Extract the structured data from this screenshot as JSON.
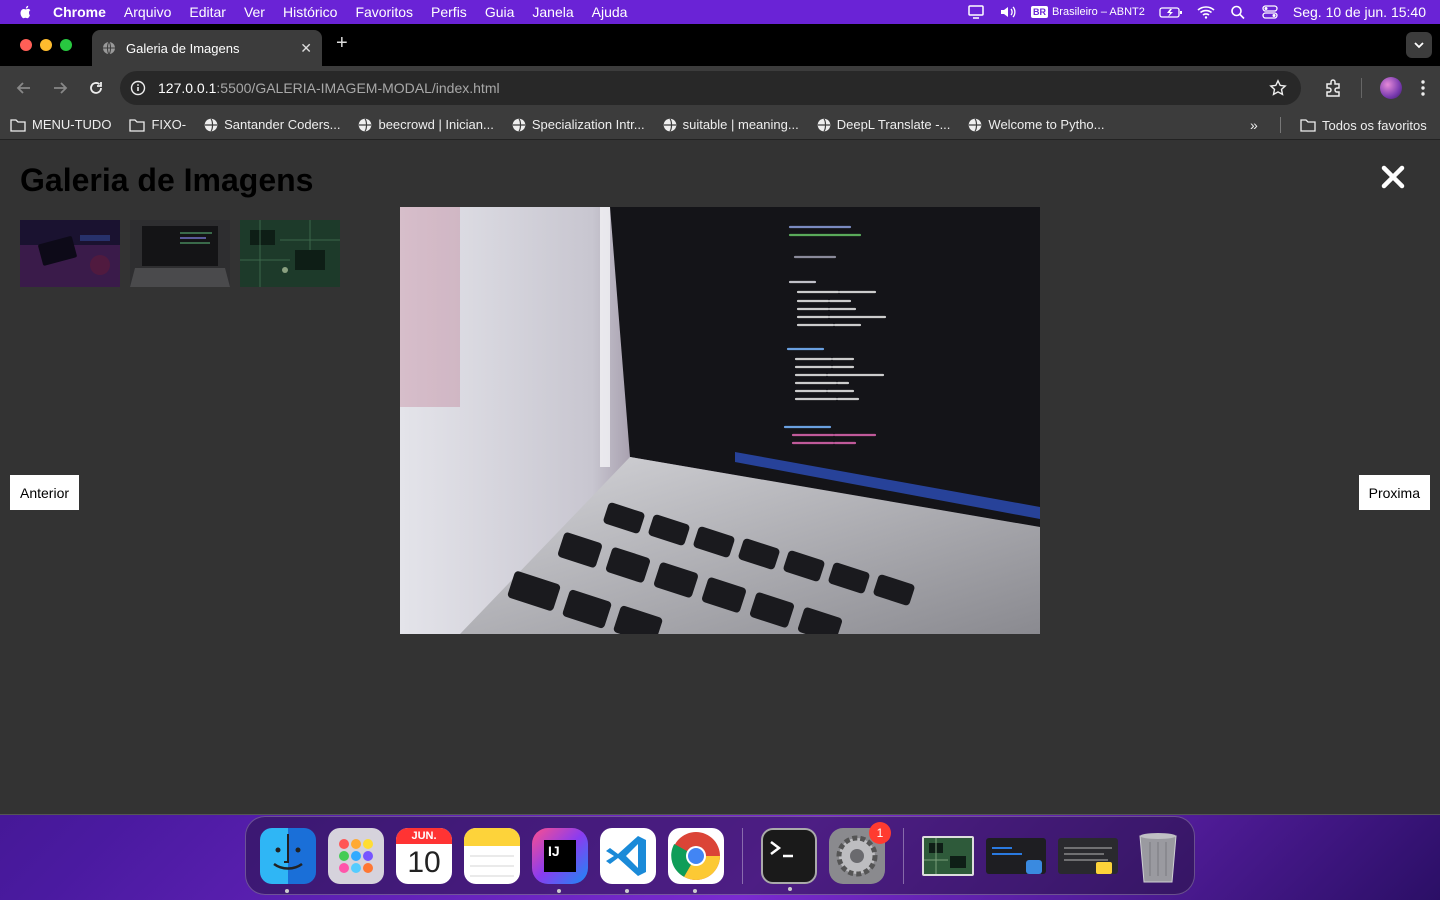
{
  "menubar": {
    "app_name": "Chrome",
    "items": [
      "Arquivo",
      "Editar",
      "Ver",
      "Histórico",
      "Favoritos",
      "Perfis",
      "Guia",
      "Janela",
      "Ajuda"
    ],
    "keyboard_flag": "BR",
    "keyboard_label": "Brasileiro – ABNT2",
    "datetime": "Seg. 10 de jun.  15:40"
  },
  "browser": {
    "tab_title": "Galeria de Imagens",
    "url_host": "127.0.0.1",
    "url_path": ":5500/GALERIA-IMAGEM-MODAL/index.html",
    "bookmarks": [
      {
        "label": "MENU-TUDO",
        "icon": "folder-icon"
      },
      {
        "label": "FIXO-",
        "icon": "folder-icon"
      },
      {
        "label": "Santander Coders...",
        "icon": "globe-icon"
      },
      {
        "label": "beecrowd | Inician...",
        "icon": "globe-icon"
      },
      {
        "label": "Specialization Intr...",
        "icon": "globe-icon"
      },
      {
        "label": "suitable | meaning...",
        "icon": "globe-icon"
      },
      {
        "label": "DeepL Translate -...",
        "icon": "globe-icon"
      },
      {
        "label": "Welcome to Pytho...",
        "icon": "globe-icon"
      }
    ],
    "more_bookmarks": "»",
    "all_bookmarks_label": "Todos os favoritos"
  },
  "page": {
    "title": "Galeria de Imagens",
    "prev_label": "Anterior",
    "next_label": "Proxima",
    "close_symbol": "✖"
  },
  "dock": {
    "calendar_month": "JUN.",
    "calendar_day": "10",
    "settings_badge": "1",
    "ide_label": "IJ"
  }
}
